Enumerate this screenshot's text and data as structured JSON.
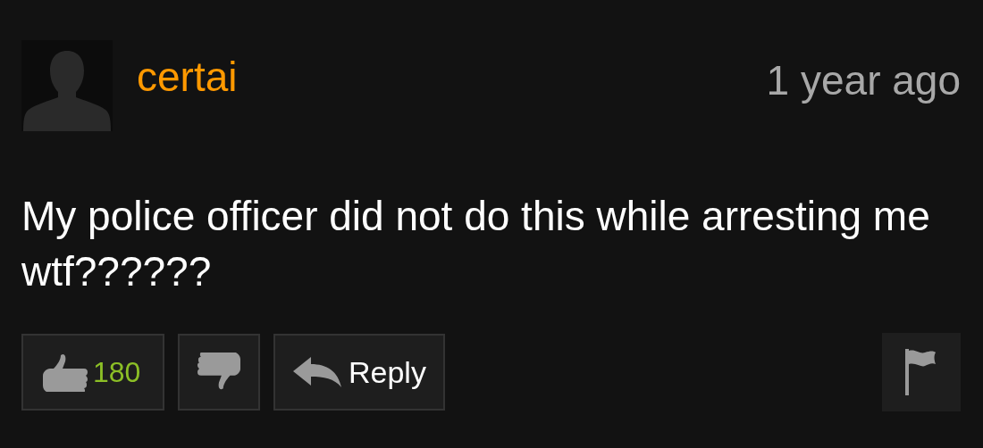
{
  "comment": {
    "username": "certai",
    "time": "1 year ago",
    "text": "My police officer did not do this while arresting me wtf??????"
  },
  "actions": {
    "likes": "180",
    "reply": "Reply"
  }
}
